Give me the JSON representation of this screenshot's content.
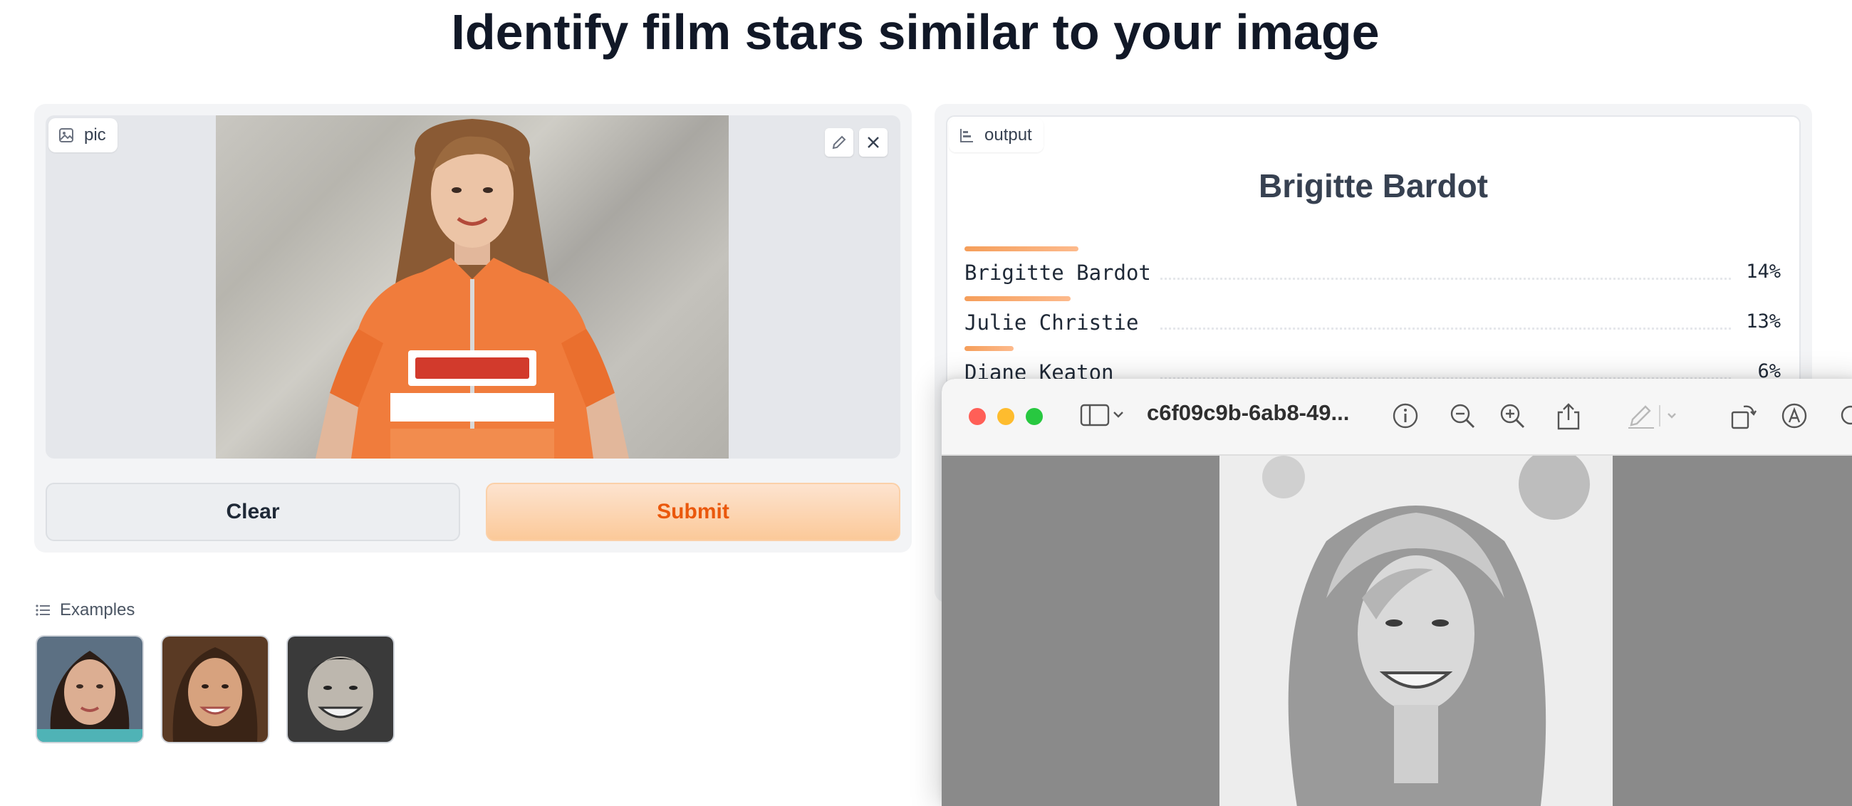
{
  "page": {
    "title": "Identify film stars similar to your image"
  },
  "input": {
    "image_label": "pic",
    "clear_label": "Clear",
    "submit_label": "Submit"
  },
  "examples": {
    "label": "Examples",
    "items": [
      "example-1",
      "example-2",
      "example-3"
    ]
  },
  "output": {
    "label": "output",
    "predicted": "Brigitte Bardot",
    "confidences": [
      {
        "label": "Brigitte Bardot",
        "pct": "14%",
        "value": 0.14
      },
      {
        "label": "Julie Christie",
        "pct": "13%",
        "value": 0.13
      },
      {
        "label": "Diane Keaton",
        "pct": "6%",
        "value": 0.06
      }
    ]
  },
  "preview_window": {
    "title": "c6f09c9b-6ab8-49...",
    "colors": {
      "close": "#ff5f57",
      "minimize": "#febc2e",
      "zoom": "#28c840"
    }
  },
  "theme": {
    "accent": "#ea580c",
    "bar": "#f59e5a"
  }
}
